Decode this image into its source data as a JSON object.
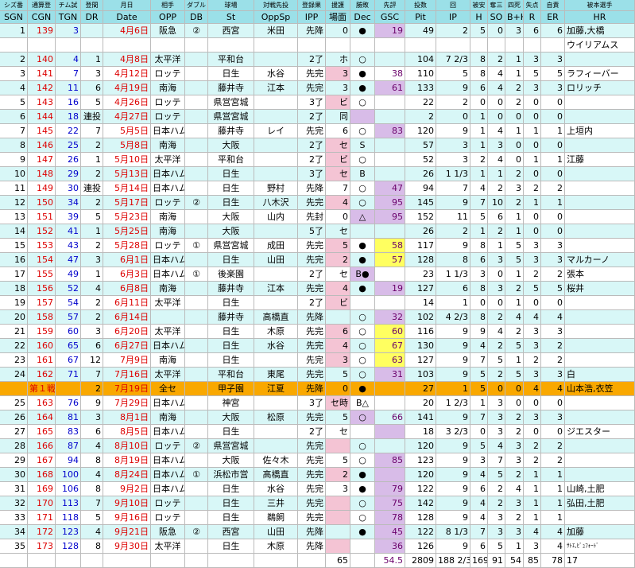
{
  "header_top": [
    "シズ番",
    "通算登",
    "チム試",
    "登間",
    "月日",
    "相手",
    "ダブル",
    "球場",
    "対戦先投",
    "登録果",
    "援護",
    "勝敗",
    "先評",
    "投数",
    "回",
    "被安",
    "奪三",
    "四死",
    "失点",
    "自責",
    "被本選手"
  ],
  "header_bottom": [
    "SGN",
    "CGN",
    "TGN",
    "DR",
    "Date",
    "OPP",
    "DB",
    "St",
    "OppSp",
    "IPP",
    "場面",
    "Dec",
    "GSC",
    "Pit",
    "IP",
    "H",
    "SO",
    "B+H",
    "R",
    "ER",
    "HR"
  ],
  "rows": [
    {
      "t": "c",
      "v": [
        "1",
        "139",
        "3",
        "",
        "4月6日",
        "阪急",
        "②",
        "西宮",
        "米田",
        "先降",
        "0",
        "●",
        "19",
        "49",
        "2",
        "5",
        "0",
        "3",
        "6",
        "6",
        "加藤,大橋"
      ]
    },
    {
      "t": "w",
      "v": [
        "",
        "",
        "",
        "",
        "",
        "",
        "",
        "",
        "",
        "",
        "",
        "",
        "",
        "",
        "",
        "",
        "",
        "",
        "",
        "",
        "ウイリアムス"
      ]
    },
    {
      "t": "c",
      "v": [
        "2",
        "140",
        "4",
        "1",
        "4月8日",
        "太平洋",
        "",
        "平和台",
        "",
        "2了",
        "ホ",
        "○",
        "",
        "104",
        "7 2/3",
        "8",
        "2",
        "1",
        "3",
        "3",
        ""
      ]
    },
    {
      "t": "w",
      "v": [
        "3",
        "141",
        "7",
        "3",
        "4月12日",
        "ロッテ",
        "",
        "日生",
        "水谷",
        "先完",
        "3",
        "●",
        "38",
        "110",
        "5",
        "8",
        "4",
        "1",
        "5",
        "5",
        "ラフィーバー"
      ]
    },
    {
      "t": "c",
      "v": [
        "4",
        "142",
        "11",
        "6",
        "4月19日",
        "南海",
        "",
        "藤井寺",
        "江本",
        "先完",
        "3",
        "●",
        "61",
        "133",
        "9",
        "6",
        "4",
        "2",
        "3",
        "3",
        "ロリッチ"
      ]
    },
    {
      "t": "w",
      "v": [
        "5",
        "143",
        "16",
        "5",
        "4月26日",
        "ロッテ",
        "",
        "県営宮城",
        "",
        "3了",
        "ビ",
        "○",
        "",
        "22",
        "2",
        "0",
        "0",
        "2",
        "0",
        "0",
        ""
      ]
    },
    {
      "t": "c",
      "v": [
        "6",
        "144",
        "18",
        "連投",
        "4月27日",
        "ロッテ",
        "",
        "県営宮城",
        "",
        "2了",
        "同",
        "",
        "",
        "2",
        "0",
        "1",
        "0",
        "0",
        "0",
        "0",
        ""
      ]
    },
    {
      "t": "w",
      "v": [
        "7",
        "145",
        "22",
        "7",
        "5月5日",
        "日本ハム",
        "",
        "藤井寺",
        "レイ",
        "先完",
        "6",
        "○",
        "83",
        "120",
        "9",
        "1",
        "4",
        "1",
        "1",
        "1",
        "上垣内"
      ]
    },
    {
      "t": "c",
      "v": [
        "8",
        "146",
        "25",
        "2",
        "5月8日",
        "南海",
        "",
        "大阪",
        "",
        "2了",
        "セ",
        "S",
        "",
        "57",
        "3",
        "1",
        "3",
        "0",
        "0",
        "0",
        ""
      ]
    },
    {
      "t": "w",
      "v": [
        "9",
        "147",
        "26",
        "1",
        "5月10日",
        "太平洋",
        "",
        "平和台",
        "",
        "2了",
        "ビ",
        "○",
        "",
        "52",
        "3",
        "2",
        "4",
        "0",
        "1",
        "1",
        "江藤"
      ]
    },
    {
      "t": "c",
      "v": [
        "10",
        "148",
        "29",
        "2",
        "5月13日",
        "日本ハム",
        "",
        "日生",
        "",
        "3了",
        "セ",
        "B",
        "",
        "26",
        "1 1/3",
        "1",
        "1",
        "2",
        "0",
        "0",
        ""
      ]
    },
    {
      "t": "w",
      "v": [
        "11",
        "149",
        "30",
        "連投",
        "5月14日",
        "日本ハム",
        "",
        "日生",
        "野村",
        "先降",
        "7",
        "○",
        "47",
        "94",
        "7",
        "4",
        "2",
        "3",
        "2",
        "2",
        ""
      ]
    },
    {
      "t": "c",
      "v": [
        "12",
        "150",
        "34",
        "2",
        "5月17日",
        "ロッテ",
        "②",
        "日生",
        "八木沢",
        "先完",
        "4",
        "○",
        "95",
        "145",
        "9",
        "7",
        "10",
        "2",
        "1",
        "1",
        ""
      ]
    },
    {
      "t": "w",
      "v": [
        "13",
        "151",
        "39",
        "5",
        "5月23日",
        "南海",
        "",
        "大阪",
        "山内",
        "先封",
        "0",
        "△",
        "95",
        "152",
        "11",
        "5",
        "6",
        "1",
        "0",
        "0",
        ""
      ]
    },
    {
      "t": "c",
      "v": [
        "14",
        "152",
        "41",
        "1",
        "5月25日",
        "南海",
        "",
        "大阪",
        "",
        "5了",
        "セ",
        "",
        "",
        "26",
        "2",
        "1",
        "2",
        "1",
        "0",
        "0",
        ""
      ]
    },
    {
      "t": "w",
      "v": [
        "15",
        "153",
        "43",
        "2",
        "5月28日",
        "ロッテ",
        "①",
        "県営宮城",
        "成田",
        "先完",
        "5",
        "●",
        "58",
        "117",
        "9",
        "8",
        "1",
        "5",
        "3",
        "3",
        ""
      ]
    },
    {
      "t": "c",
      "v": [
        "16",
        "154",
        "47",
        "3",
        "6月1日",
        "日本ハム",
        "",
        "日生",
        "山田",
        "先完",
        "2",
        "●",
        "57",
        "128",
        "8",
        "6",
        "3",
        "5",
        "3",
        "3",
        "マルカーノ"
      ]
    },
    {
      "t": "w",
      "v": [
        "17",
        "155",
        "49",
        "1",
        "6月3日",
        "日本ハム",
        "①",
        "後楽園",
        "",
        "2了",
        "セ",
        "B●",
        "",
        "23",
        "1 1/3",
        "3",
        "0",
        "1",
        "2",
        "2",
        "張本"
      ]
    },
    {
      "t": "c",
      "v": [
        "18",
        "156",
        "52",
        "4",
        "6月8日",
        "南海",
        "",
        "藤井寺",
        "江本",
        "先完",
        "4",
        "●",
        "19",
        "127",
        "6",
        "8",
        "3",
        "2",
        "5",
        "5",
        "桜井"
      ]
    },
    {
      "t": "w",
      "v": [
        "19",
        "157",
        "54",
        "2",
        "6月11日",
        "太平洋",
        "",
        "日生",
        "",
        "2了",
        "ビ",
        "",
        "",
        "14",
        "1",
        "0",
        "0",
        "1",
        "0",
        "0",
        ""
      ]
    },
    {
      "t": "c",
      "v": [
        "20",
        "158",
        "57",
        "2",
        "6月14日",
        "",
        "",
        "藤井寺",
        "高橋直",
        "先降",
        "",
        "○",
        "32",
        "102",
        "4 2/3",
        "8",
        "2",
        "4",
        "4",
        "4",
        ""
      ]
    },
    {
      "t": "w",
      "v": [
        "21",
        "159",
        "60",
        "3",
        "6月20日",
        "太平洋",
        "",
        "日生",
        "木原",
        "先完",
        "6",
        "○",
        "60",
        "116",
        "9",
        "9",
        "4",
        "2",
        "3",
        "3",
        ""
      ]
    },
    {
      "t": "c",
      "v": [
        "22",
        "160",
        "65",
        "6",
        "6月27日",
        "日本ハム",
        "",
        "日生",
        "水谷",
        "先完",
        "4",
        "○",
        "67",
        "130",
        "9",
        "4",
        "2",
        "5",
        "3",
        "2",
        ""
      ]
    },
    {
      "t": "w",
      "v": [
        "23",
        "161",
        "67",
        "12",
        "7月9日",
        "南海",
        "",
        "日生",
        "",
        "先完",
        "3",
        "○",
        "63",
        "127",
        "9",
        "7",
        "5",
        "1",
        "2",
        "2",
        ""
      ]
    },
    {
      "t": "c",
      "v": [
        "24",
        "162",
        "71",
        "7",
        "7月16日",
        "太平洋",
        "",
        "平和台",
        "東尾",
        "先完",
        "5",
        "○",
        "31",
        "103",
        "9",
        "5",
        "2",
        "5",
        "3",
        "3",
        "白"
      ]
    },
    {
      "t": "g",
      "v": [
        "",
        "第１戦",
        "",
        "2",
        "7月19日",
        "全セ",
        "",
        "甲子園",
        "江夏",
        "先降",
        "0",
        "●",
        "",
        "27",
        "1",
        "5",
        "0",
        "0",
        "4",
        "4",
        "山本浩,衣笠"
      ]
    },
    {
      "t": "w",
      "v": [
        "25",
        "163",
        "76",
        "9",
        "7月29日",
        "日本ハム",
        "",
        "神宮",
        "",
        "3了",
        "セ時",
        "B△",
        "",
        "20",
        "1 2/3",
        "1",
        "3",
        "0",
        "0",
        "0",
        ""
      ]
    },
    {
      "t": "c",
      "v": [
        "26",
        "164",
        "81",
        "3",
        "8月1日",
        "南海",
        "",
        "大阪",
        "松原",
        "先完",
        "5",
        "○",
        "66",
        "141",
        "9",
        "7",
        "3",
        "2",
        "3",
        "3",
        ""
      ]
    },
    {
      "t": "w",
      "v": [
        "27",
        "165",
        "83",
        "6",
        "8月5日",
        "日本ハム",
        "",
        "日生",
        "",
        "2了",
        "セ",
        "",
        "",
        "18",
        "3 2/3",
        "0",
        "3",
        "2",
        "0",
        "0",
        "ジエスター"
      ]
    },
    {
      "t": "c",
      "v": [
        "28",
        "166",
        "87",
        "4",
        "8月10日",
        "ロッテ",
        "②",
        "県営宮城",
        "",
        "先完",
        "",
        "○",
        "",
        "120",
        "9",
        "5",
        "4",
        "3",
        "2",
        "2",
        ""
      ]
    },
    {
      "t": "w",
      "v": [
        "29",
        "167",
        "94",
        "8",
        "8月19日",
        "日本ハム",
        "",
        "大阪",
        "佐々木",
        "先完",
        "5",
        "○",
        "85",
        "123",
        "9",
        "3",
        "7",
        "3",
        "2",
        "2",
        ""
      ]
    },
    {
      "t": "c",
      "v": [
        "30",
        "168",
        "100",
        "4",
        "8月24日",
        "日本ハム",
        "①",
        "浜松市営",
        "高橋直",
        "先完",
        "2",
        "●",
        "",
        "120",
        "9",
        "4",
        "5",
        "2",
        "1",
        "1",
        ""
      ]
    },
    {
      "t": "w",
      "v": [
        "31",
        "169",
        "106",
        "8",
        "9月2日",
        "日本ハム",
        "",
        "日生",
        "水谷",
        "先完",
        "3",
        "●",
        "79",
        "122",
        "9",
        "6",
        "2",
        "4",
        "1",
        "1",
        "山崎,土肥"
      ]
    },
    {
      "t": "c",
      "v": [
        "32",
        "170",
        "113",
        "7",
        "9月10日",
        "ロッテ",
        "",
        "日生",
        "三井",
        "先完",
        "",
        "○",
        "75",
        "142",
        "9",
        "4",
        "2",
        "3",
        "1",
        "1",
        "弘田,土肥"
      ]
    },
    {
      "t": "w",
      "v": [
        "33",
        "171",
        "118",
        "5",
        "9月16日",
        "ロッテ",
        "",
        "日生",
        "鵜飼",
        "先完",
        "",
        "○",
        "78",
        "128",
        "9",
        "4",
        "3",
        "2",
        "1",
        "1",
        ""
      ]
    },
    {
      "t": "c",
      "v": [
        "34",
        "172",
        "123",
        "4",
        "9月21日",
        "阪急",
        "②",
        "西宮",
        "山田",
        "先降",
        "",
        "●",
        "45",
        "122",
        "8 1/3",
        "7",
        "3",
        "3",
        "4",
        "4",
        "加藤"
      ]
    },
    {
      "t": "w",
      "v": [
        "35",
        "173",
        "128",
        "8",
        "9月30日",
        "太平洋",
        "",
        "日生",
        "木原",
        "先降",
        "",
        "",
        "36",
        "126",
        "9",
        "6",
        "5",
        "1",
        "3",
        "4",
        "ｻﾄｴ,ﾋﾞｭﾌｫｰﾄﾞ"
      ]
    }
  ],
  "totals": [
    "",
    "",
    "",
    "",
    "",
    "",
    "",
    "",
    "",
    "",
    "65",
    "",
    "54.5",
    "2809",
    "188 2/3",
    "169",
    "91",
    "54",
    "85",
    "78",
    "17"
  ],
  "colors": {
    "header": "#9be0e8",
    "cyan": "#d8f7f7",
    "gold": "#f9a800",
    "gsc_yellow": "#ffff60",
    "gsc_lavender": "#d8bce8",
    "dec_lavender": "#d8bce8"
  },
  "gsc_yellow_rows": [
    15,
    16,
    21,
    22,
    23
  ],
  "dec_lavender_rows": [
    6,
    13,
    17,
    26
  ],
  "dec_pink_rows": [
    3,
    5,
    8,
    9,
    10,
    12,
    15,
    16,
    18,
    19,
    21,
    22,
    23,
    25,
    28,
    30,
    32,
    33,
    35
  ],
  "gsc_lavender_rows": [
    1,
    4,
    7,
    11,
    12,
    13,
    18,
    20,
    24,
    27,
    29,
    30,
    31,
    32,
    33,
    34,
    35
  ]
}
